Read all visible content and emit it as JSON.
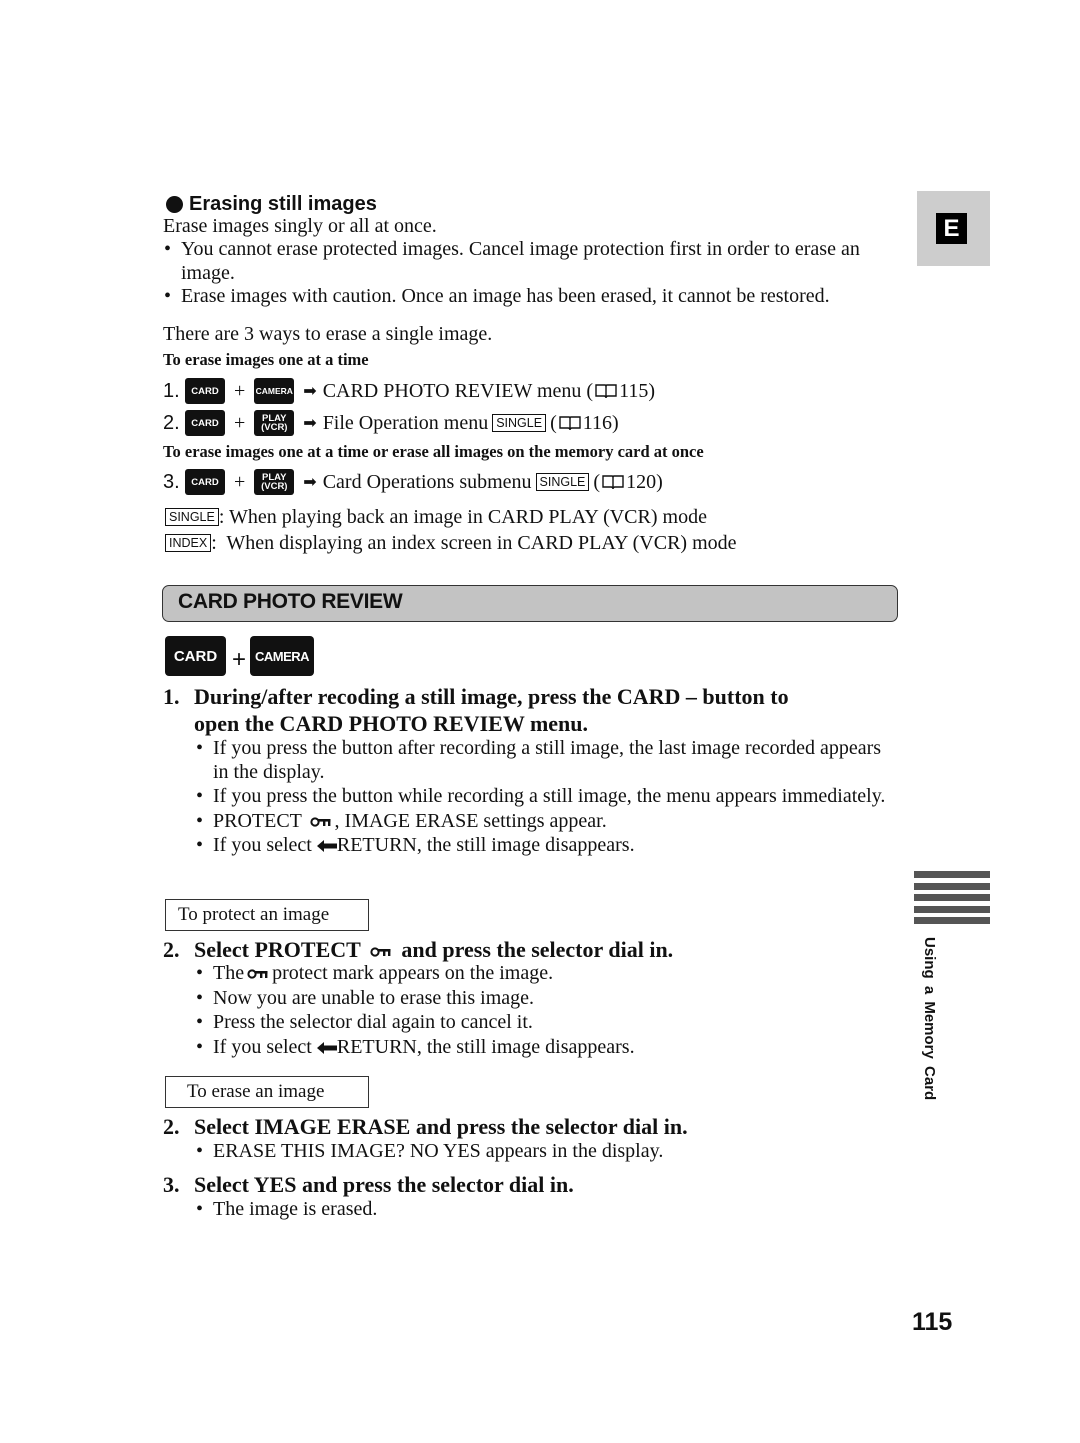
{
  "erasing": {
    "heading": "Erasing still images",
    "intro": "Erase images singly or all at once.",
    "bullets": [
      "You cannot erase protected images. Cancel image protection first in order to erase an image.",
      "Erase images with caution. Once an image has been erased, it cannot be restored."
    ],
    "ways_text": "There are 3 ways to erase a single image.",
    "one_at_time_label": "To erase images one at a time",
    "one_or_all_label": "To erase images one at a time or erase all images on the memory card at once",
    "steps": [
      {
        "num": "1.",
        "key1": "CARD",
        "key2_line1": "CAMERA",
        "key2_line2": "",
        "text": "CARD PHOTO REVIEW menu (",
        "tag": "",
        "page": "115)"
      },
      {
        "num": "2.",
        "key1": "CARD",
        "key2_line1": "PLAY",
        "key2_line2": "(VCR)",
        "text": "File Operation menu",
        "tag": "SINGLE",
        "page": "116)"
      },
      {
        "num": "3.",
        "key1": "CARD",
        "key2_line1": "PLAY",
        "key2_line2": "(VCR)",
        "text": "Card Operations submenu",
        "tag": "SINGLE",
        "page": "120)"
      }
    ],
    "modes": [
      {
        "tag": "SINGLE",
        "text": ": When playing back an image in CARD PLAY (VCR) mode"
      },
      {
        "tag": "INDEX",
        "text": ":  When displaying an index screen in CARD PLAY (VCR) mode"
      }
    ],
    "plus": "+",
    "open_paren": "("
  },
  "section": {
    "title": "CARD PHOTO REVIEW",
    "key1": "CARD",
    "key2": "CAMERA",
    "plus": "+"
  },
  "step1": {
    "num": "1.",
    "title_line1": "During/after recoding a still image, press the CARD – button to",
    "title_line2": "open the CARD PHOTO REVIEW menu.",
    "bullets": [
      "If you press the button after recording a still image, the last image recorded appears in the display.",
      "If you press the button while recording a still image, the menu appears immediately."
    ],
    "protect_bullet_pre": "PROTECT",
    "protect_bullet_post": ", IMAGE ERASE settings appear.",
    "return_bullet_pre": "If you select",
    "return_bullet_post": "RETURN, the still image disappears."
  },
  "protect": {
    "box_label": "To protect an image",
    "num": "2.",
    "title_pre": "Select PROTECT",
    "title_post": "and press the selector dial in.",
    "bullet1_pre": "The",
    "bullet1_post": "protect mark appears on the image.",
    "bullet2": "Now you are unable to erase this image.",
    "bullet3": "Press the selector dial again to cancel it.",
    "bullet4_pre": "If you select",
    "bullet4_post": "RETURN, the still image disappears."
  },
  "erase": {
    "box_label": "To erase an image",
    "step2_num": "2.",
    "step2_title": "Select IMAGE ERASE and press the selector dial in.",
    "step2_bullet": "ERASE THIS IMAGE? NO YES appears in the display.",
    "step3_num": "3.",
    "step3_title": "Select YES and press the selector dial in.",
    "step3_bullet": "The image is erased."
  },
  "sidebar": {
    "language_tab": "E",
    "chapter_label": "Using a Memory Card"
  },
  "page_number": "115"
}
